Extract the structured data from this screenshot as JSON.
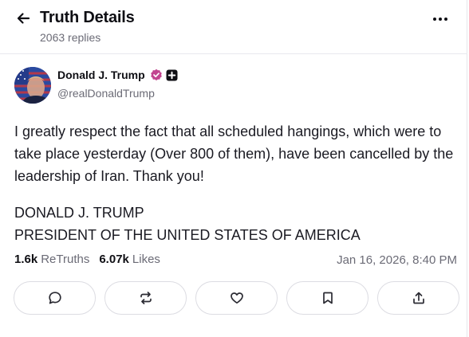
{
  "header": {
    "title": "Truth Details",
    "replies": "2063 replies"
  },
  "author": {
    "name": "Donald J. Trump",
    "handle": "@realDonaldTrump"
  },
  "post": {
    "text": "I greatly respect the fact that all scheduled hangings, which were to take place yesterday (Over 800 of them), have been cancelled by the leadership of Iran. Thank you!",
    "signature_line1": "DONALD J. TRUMP",
    "signature_line2": "PRESIDENT OF THE UNITED STATES OF AMERICA"
  },
  "stats": {
    "retruths_count": "1.6k",
    "retruths_label": "ReTruths",
    "likes_count": "6.07k",
    "likes_label": "Likes",
    "timestamp": "Jan 16, 2026, 8:40 PM"
  },
  "icons": {
    "back": "arrow-left-icon",
    "more": "more-horizontal-icon",
    "verified": "verified-badge-icon",
    "plus": "plus-badge-icon",
    "reply": "comment-icon",
    "retruth": "repost-icon",
    "like": "heart-icon",
    "bookmark": "bookmark-icon",
    "share": "share-icon"
  },
  "colors": {
    "verified": "#c1448f",
    "text": "#0f0f14",
    "muted": "#6b6b76"
  }
}
